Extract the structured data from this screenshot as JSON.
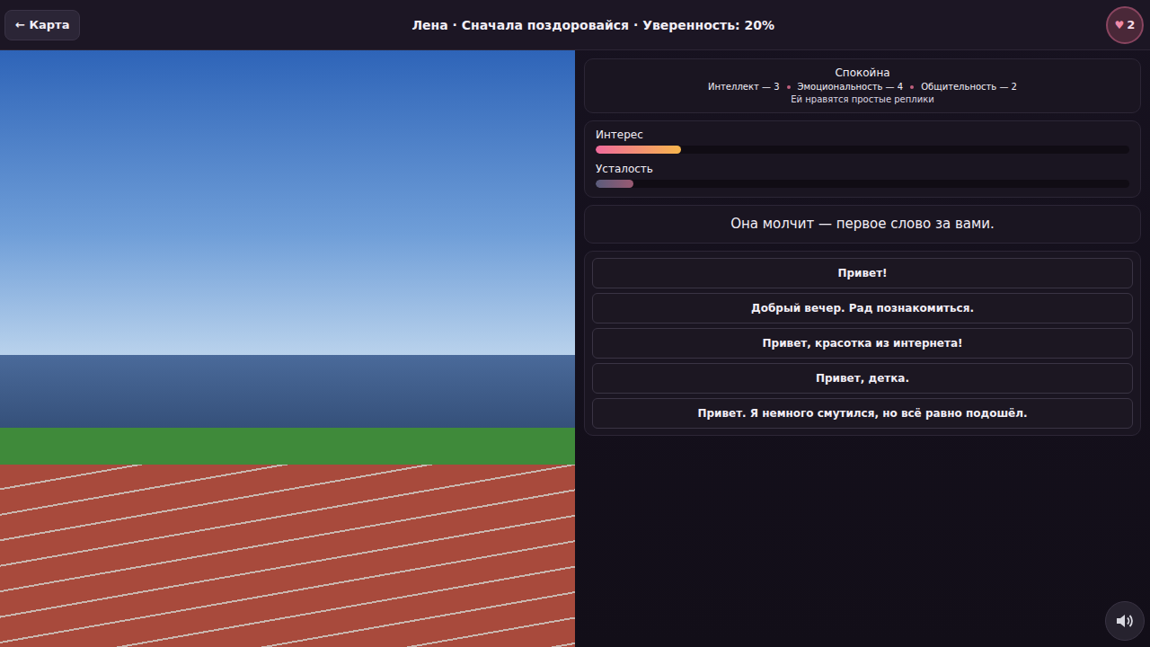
{
  "topbar": {
    "back": "← Карта",
    "title": "Лена · Сначала поздоровайся · Уверенность: 20%",
    "hearts": {
      "icon": "♥",
      "count": "2"
    }
  },
  "mood": {
    "state": "Спокойна",
    "traits": [
      "Интеллект — 3",
      "Эмоциональность — 4",
      "Общительность — 2"
    ],
    "hint": "Ей нравятся простые реплики"
  },
  "meters": [
    {
      "label": "Интерес",
      "level": 0.16,
      "kind": "interest"
    },
    {
      "label": "Усталость",
      "level": 0.07,
      "kind": "fatigue"
    }
  ],
  "narration": "Она молчит — первое слово за вами.",
  "choices": [
    "Привет!",
    "Добрый вечер. Рад познакомиться.",
    "Привет, красотка из интернета!",
    "Привет, детка.",
    "Привет. Я немного смутился, но всё равно подошёл."
  ]
}
